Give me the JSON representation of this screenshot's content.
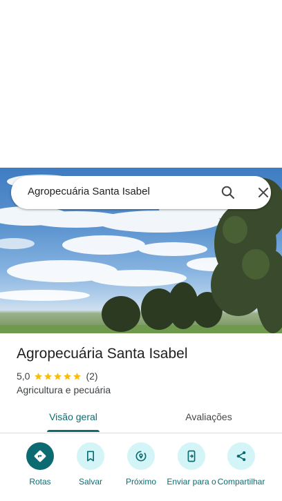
{
  "search": {
    "query": "Agropecuária Santa Isabel"
  },
  "place": {
    "name": "Agropecuária Santa Isabel",
    "rating": "5,0",
    "stars": 5,
    "review_count": "(2)",
    "category": "Agricultura e pecuária"
  },
  "tabs": {
    "overview": "Visão geral",
    "reviews": "Avaliações"
  },
  "actions": {
    "directions": "Rotas",
    "save": "Salvar",
    "nearby": "Próximo",
    "send": "Enviar para o",
    "share": "Compartilhar"
  },
  "colors": {
    "accent": "#0b6b70",
    "action_bg": "#d4f5f7",
    "star": "#fbbc04"
  }
}
